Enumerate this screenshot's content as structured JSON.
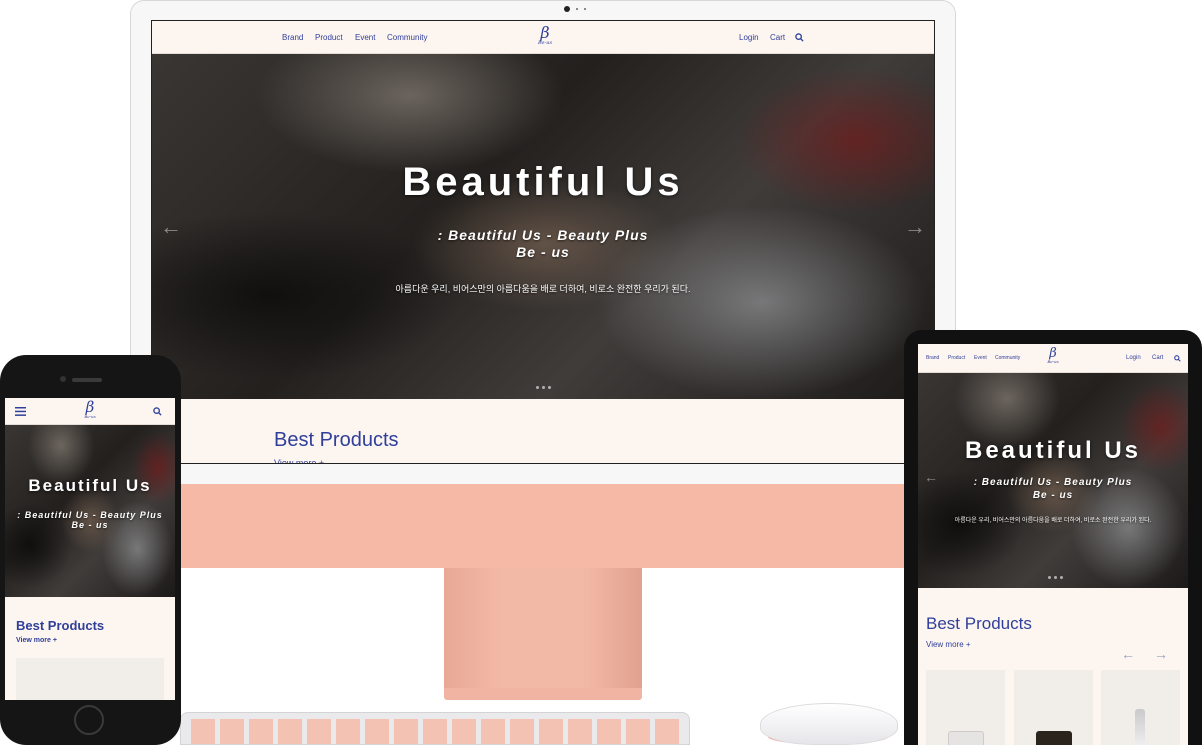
{
  "brand": {
    "logo_mark": "β",
    "logo_text": "Be-us"
  },
  "nav": {
    "items": [
      "Brand",
      "Product",
      "Event",
      "Community"
    ],
    "login": "Login",
    "cart": "Cart"
  },
  "hero": {
    "title": "Beautiful Us",
    "subtitle_line1": ": Beautiful Us - Beauty Plus",
    "subtitle_line2": "Be - us",
    "description": "아름다운 우리, 비어스만의 아름다움을 배로 더하여, 비로소 완전한 우리가 된다.",
    "prev_arrow": "←",
    "next_arrow": "→"
  },
  "best": {
    "title": "Best Products",
    "view_more": "View more +"
  },
  "icons": {
    "search": "search-icon",
    "menu": "hamburger-menu-icon",
    "prev": "arrow-left-icon",
    "next": "arrow-right-icon"
  },
  "colors": {
    "brand_blue": "#2f3f9a",
    "page_bg": "#fdf5f0",
    "imac_pink": "#f6b9a5"
  }
}
